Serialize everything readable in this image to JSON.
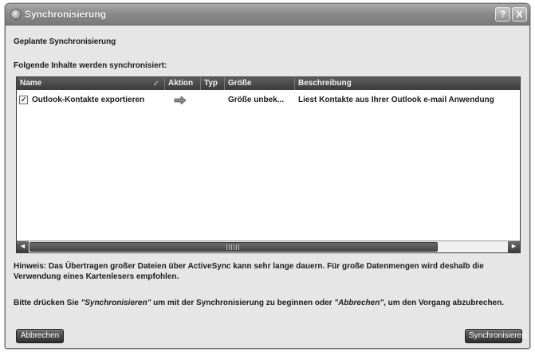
{
  "window": {
    "title": "Synchronisierung",
    "help_glyph": "?",
    "close_glyph": "X",
    "icon": "app-globe-icon"
  },
  "heading": "Geplante Synchronisierung",
  "list_label": "Folgende Inhalte werden synchronisiert:",
  "list": {
    "columns": [
      "Name",
      "Aktion",
      "Typ",
      "Größe",
      "Beschreibung"
    ],
    "sort_indicator": "✓",
    "rows": [
      {
        "checked": true,
        "name": "Outlook-Kontakte exportieren",
        "action_icon": "arrow-right-icon",
        "type": "",
        "size": "Größe unbek...",
        "description": "Liest Kontakte aus Ihrer Outlook e-mail Anwendung"
      }
    ]
  },
  "scrollbar": {
    "left_glyph": "◀",
    "right_glyph": "▶"
  },
  "note": "Hinweis: Das Übertragen großer Dateien über ActiveSync kann sehr lange dauern. Für große Datenmengen wird deshalb die Verwendung eines Kartenlesers empfohlen.",
  "instruction": {
    "part1": "Bitte drücken Sie ",
    "sync_word": "\"Synchronisieren\"",
    "part2": " um mit der Synchronisierung zu beginnen oder ",
    "cancel_word": "\"Abbrechen\"",
    "part3": ", um den Vorgang abzubrechen."
  },
  "buttons": {
    "cancel": "Abbrechen",
    "sync": "Synchronisieren"
  },
  "colors": {
    "titlebar": "#8b8b8b",
    "header": "#3b3b3b",
    "button": "#2f2f2f"
  }
}
